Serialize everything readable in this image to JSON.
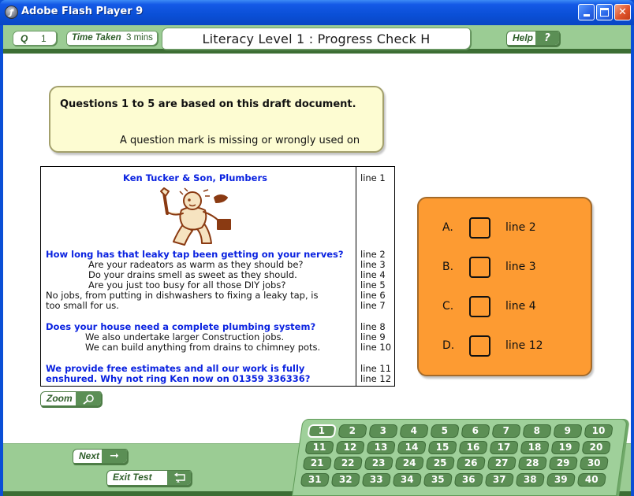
{
  "window": {
    "title": "Adobe Flash Player 9",
    "controls": {
      "minimize": "minimize",
      "maximize": "maximize",
      "close": "close"
    }
  },
  "header": {
    "question_label": "Q",
    "question_number": "1",
    "time_label": "Time Taken",
    "time_value": "3 mins",
    "title": "Literacy Level 1 : Progress Check H",
    "help_label": "Help",
    "help_icon": "?"
  },
  "instruction": {
    "heading": "Questions 1 to 5 are based on this draft document.",
    "prompt": "A question mark is missing or wrongly used on"
  },
  "document": {
    "image": "plumber-illustration",
    "rows": [
      {
        "text": "Ken Tucker & Son, Plumbers",
        "style": "blue",
        "line": "line 1"
      },
      {
        "text": "How long has that leaky tap been getting on your nerves?",
        "style": "blue",
        "line": "line 2"
      },
      {
        "text": "Are your radeators as warm as they should be?",
        "style": "indent",
        "line": "line 3"
      },
      {
        "text": "Do your drains smell as sweet as they should.",
        "style": "indent",
        "line": "line 4"
      },
      {
        "text": "Are you just too busy for all those DIY jobs?",
        "style": "indent",
        "line": "line 5"
      },
      {
        "text": "No jobs, from putting in dishwashers to fixing a leaky tap, is",
        "style": "normal",
        "line": "line 6"
      },
      {
        "text": "too small for us.",
        "style": "normal",
        "line": "line 7"
      },
      {
        "text": "Does your house need a complete plumbing system?",
        "style": "blue",
        "line": "line 8"
      },
      {
        "text": "We also undertake larger Construction jobs.",
        "style": "indent",
        "line": "line 9"
      },
      {
        "text": "We can build anything from drains to chimney pots.",
        "style": "indent",
        "line": "line 10"
      },
      {
        "text": "We provide free estimates and all our work is fully",
        "style": "blue",
        "line": "line 11"
      },
      {
        "text": "enshured. Why not ring Ken now on 01359 336336?",
        "style": "blue",
        "line": "line 12"
      }
    ]
  },
  "answers": {
    "options": [
      {
        "letter": "A.",
        "text": "line 2",
        "checked": false
      },
      {
        "letter": "B.",
        "text": "line 3",
        "checked": false
      },
      {
        "letter": "C.",
        "text": "line 4",
        "checked": false
      },
      {
        "letter": "D.",
        "text": "line 12",
        "checked": false
      }
    ]
  },
  "toolbar": {
    "zoom_label": "Zoom",
    "next_label": "Next",
    "exit_label": "Exit Test"
  },
  "question_nav": {
    "current": 1,
    "numbers": [
      "1",
      "2",
      "3",
      "4",
      "5",
      "6",
      "7",
      "8",
      "9",
      "10",
      "11",
      "12",
      "13",
      "14",
      "15",
      "16",
      "17",
      "18",
      "19",
      "20",
      "21",
      "22",
      "23",
      "24",
      "25",
      "26",
      "27",
      "28",
      "29",
      "30",
      "31",
      "32",
      "33",
      "34",
      "35",
      "36",
      "37",
      "38",
      "39",
      "40"
    ]
  },
  "colors": {
    "panel_green": "#9bcc94",
    "dark_green": "#3c6e34",
    "answer_orange": "#fd9b32",
    "instruction_yellow": "#fdfcd2",
    "doc_blue": "#0a22e0"
  }
}
